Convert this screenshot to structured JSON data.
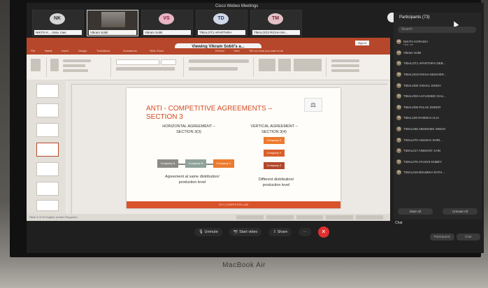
{
  "meeting_title": "Cisco Webex Meetings",
  "laptop_model": "MacBook Air",
  "video_tiles": [
    {
      "initials": "NK",
      "name": "NIKITA K...   nirav, mas"
    },
    {
      "initials": "",
      "name": "Vikram Sobti"
    },
    {
      "initials": "VS",
      "name": "Vikram Sobti"
    },
    {
      "initials": "TD",
      "name": "TIBALOT1 APARTHRA"
    },
    {
      "initials": "TM",
      "name": "TIBALOO3 RICHA MA..."
    }
  ],
  "participants_panel": {
    "title": "Participants (73)",
    "search_placeholder": "Search",
    "participants": [
      {
        "initials": "NK",
        "name": "NIKITA KORADIA",
        "sub": "Host, me"
      },
      {
        "initials": "VS",
        "name": "Vikram Sobti",
        "sub": ""
      },
      {
        "initials": "TD",
        "name": "TIBALOT1 APARTHRA DEB...",
        "sub": ""
      },
      {
        "initials": "TM",
        "name": "TIBALOO3 RICHA MUKHER...",
        "sub": ""
      },
      {
        "initials": "TS",
        "name": "TIBALO06 VISHAL SINGH",
        "sub": ""
      },
      {
        "initials": "TG",
        "name": "TIBALO03 AAYUSHEE GAU...",
        "sub": ""
      },
      {
        "initials": "TD",
        "name": "TIBALO05 PALAK DHEER",
        "sub": ""
      },
      {
        "initials": "TA",
        "name": "TIBAL100 RAMSHA ALIA",
        "sub": ""
      },
      {
        "initials": "TS",
        "name": "T38AL008 ABHISHEK SINGH",
        "sub": ""
      },
      {
        "initials": "TS",
        "name": "T38AL070 ANUSHA SHRI...",
        "sub": ""
      },
      {
        "initials": "TJ",
        "name": "T38AL017 ANIMANT JAIN",
        "sub": ""
      },
      {
        "initials": "TD",
        "name": "T38AL075 AYUSHI DUBEY",
        "sub": ""
      },
      {
        "initials": "TR",
        "name": "T38AL018 BHUMIKA RATH...",
        "sub": ""
      }
    ],
    "mute_all": "Mute All",
    "unmute_all": "Unmute All"
  },
  "chat": {
    "tab_label": "Chat",
    "participants_btn": "Participants",
    "chat_btn": "Chat"
  },
  "ppt": {
    "viewing_banner": "Viewing Vikram Sobti's a...",
    "sign_in": "Sign in",
    "tell_me": "Tell me what you want to do",
    "tabs": [
      "File",
      "Home",
      "Insert",
      "Design",
      "Transitions",
      "Animations",
      "Slide Show",
      "Review",
      "View"
    ],
    "status_left": "Slide 3 of 10   English (United Kingdom)",
    "slide": {
      "title_line1": "ANTI - COMPETITIVE AGREEMENTS –",
      "title_line2": "SECTION 3",
      "horizontal_heading_1": "HORIZONTAL AGREEMENT –",
      "horizontal_heading_2": "SECTION 3(3)",
      "vertical_heading_1": "VERTICAL AGREEMENT –",
      "vertical_heading_2": "SECTION 3(4)",
      "h_boxes": [
        "Company A",
        "Company B",
        "Company C"
      ],
      "v_boxes": [
        "Company X",
        "Company Y",
        "Company Z"
      ],
      "horizontal_caption_1": "Agreement at same distribution/",
      "horizontal_caption_2": "production level",
      "vertical_caption_1": "Different distribution/",
      "vertical_caption_2": "production level",
      "footer": "ICSI | COMPETITION LAW"
    }
  },
  "controls": {
    "unmute": "Unmute",
    "start_video": "Start video",
    "share": "Share",
    "more": "···",
    "end": "✕"
  },
  "colors": {
    "ppt_accent": "#b7472a",
    "slide_title": "#d14b22",
    "box_grey": "#8d8b86",
    "box_orange": "#ec7a2e",
    "end_red": "#e02f2f"
  }
}
